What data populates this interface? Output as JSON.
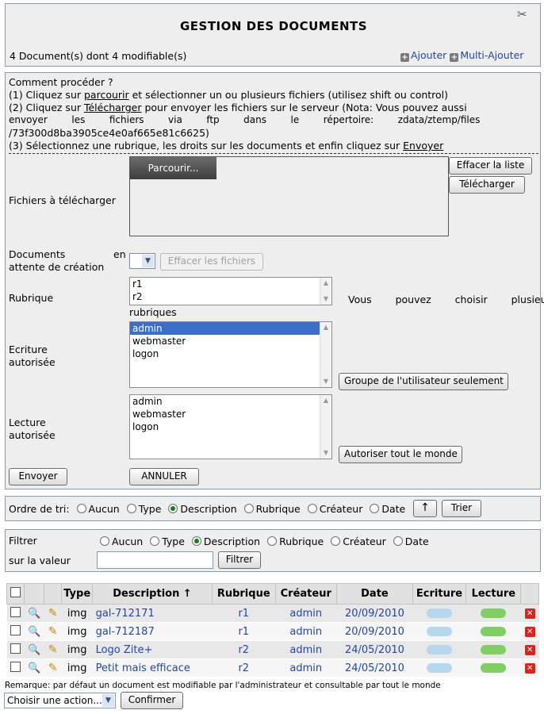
{
  "header": {
    "title": "GESTION DES DOCUMENTS",
    "summary": "4 Document(s) dont 4 modifiable(s)",
    "add_label": "Ajouter",
    "multi_add_label": "Multi-Ajouter"
  },
  "instructions": {
    "heading": "Comment procéder ?",
    "step1_pre": "(1) Cliquez sur ",
    "step1_link": "parcourir",
    "step1_post": " et sélectionner un ou plusieurs fichiers (utilisez shift ou control)",
    "step2_pre": "(2) Cliquez sur ",
    "step2_link": "Télécharger",
    "step2_line1_rest": " pour envoyer les fichiers sur le serveur (Nota: Vous pouvez aussi",
    "step2_line2": "envoyer        les        fichiers        via        ftp        dans        le        répertoire:        zdata/ztemp/files",
    "step2_line3": "/73f300d8ba3905ce4e0af665e81c6625)",
    "step3_pre": "(3) Sélectionnez une rubrique, les droits sur les documents et enfin cliquez sur ",
    "step3_link": "Envoyer"
  },
  "upload": {
    "files_label": "Fichiers à télécharger",
    "browse_label": "Parcourir...",
    "clear_list_label": "Effacer la liste",
    "download_label": "Télécharger",
    "pending_label_1": "Documents",
    "pending_label_en": "en",
    "pending_label_2": "attente de création",
    "clear_files_label": "Effacer les fichiers",
    "rubrique_label": "Rubrique",
    "rubriques": [
      "r1",
      "r2"
    ],
    "rubrique_hint": "Vous   pouvez   choisir   plusieurs",
    "rubrique_hint_2": "rubriques",
    "write_label_1": "Ecriture",
    "write_label_2": "autorisée",
    "write_options": [
      "admin",
      "webmaster",
      "logon"
    ],
    "write_selected": "admin",
    "group_only_label": "Groupe de l'utilisateur seulement",
    "read_label_1": "Lecture",
    "read_label_2": "autorisée",
    "read_options": [
      "admin",
      "webmaster",
      "logon"
    ],
    "allow_all_label": "Autoriser tout le monde",
    "send_label": "Envoyer",
    "cancel_label": "ANNULER"
  },
  "sort": {
    "label": "Ordre de tri:",
    "options": [
      "Aucun",
      "Type",
      "Description",
      "Rubrique",
      "Créateur",
      "Date"
    ],
    "selected": "Description",
    "direction_icon": "↑",
    "button": "Trier"
  },
  "filter": {
    "label": "Filtrer",
    "value_label": "sur la valeur",
    "options": [
      "Aucun",
      "Type",
      "Description",
      "Rubrique",
      "Créateur",
      "Date"
    ],
    "selected": "Description",
    "value": "",
    "button": "Filtrer"
  },
  "table": {
    "columns": [
      "Type",
      "Description ↑",
      "Rubrique",
      "Créateur",
      "Date",
      "Ecriture",
      "Lecture"
    ],
    "rows": [
      {
        "type": "img",
        "description": "gal-712171",
        "rubrique": "r1",
        "createur": "admin",
        "date": "20/09/2010"
      },
      {
        "type": "img",
        "description": "gal-712187",
        "rubrique": "r1",
        "createur": "admin",
        "date": "20/09/2010"
      },
      {
        "type": "img",
        "description": "Logo Zite+",
        "rubrique": "r2",
        "createur": "admin",
        "date": "24/05/2010"
      },
      {
        "type": "img",
        "description": "Petit mais efficace",
        "rubrique": "r2",
        "createur": "admin",
        "date": "24/05/2010"
      }
    ]
  },
  "footer": {
    "remark": "Remarque: par défaut un document est modifiable par l'administrateur et consultable par tout le monde",
    "action_select": "Choisir une action...",
    "confirm_label": "Confirmer"
  },
  "colors": {
    "panel_bg": "#eeeeee",
    "link": "#2346a8",
    "selection": "#3b6fc6",
    "write_pill": "#b7d7ee",
    "read_pill": "#7fcf62",
    "delete": "#d9241b"
  },
  "icons": {
    "tools": "tools-icon",
    "add": "plus-icon",
    "view": "magnifier-icon",
    "edit": "edit-icon",
    "delete": "delete-icon",
    "write": "write-permission-icon",
    "read": "read-permission-icon"
  }
}
